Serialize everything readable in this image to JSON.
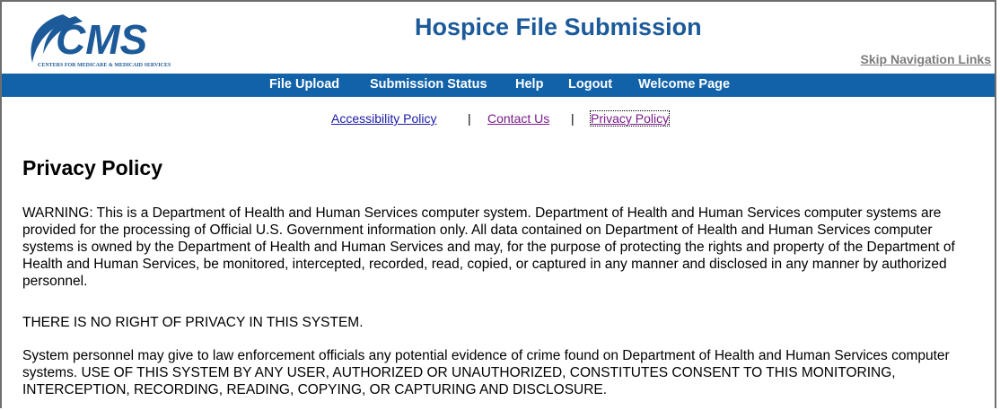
{
  "colors": {
    "brand_blue": "#1c5a9a",
    "nav_bar": "#1162a8",
    "link_visited": "#7b1a8a",
    "link_blue": "#1a1aa6",
    "skip_link_gray": "#7c7c7c"
  },
  "header": {
    "logo_text": "CMS",
    "logo_subtitle": "CENTERS FOR MEDICARE & MEDICAID SERVICES",
    "site_title": "Hospice File Submission",
    "skip_link": "Skip Navigation Links"
  },
  "nav": {
    "items": [
      {
        "label": "File Upload"
      },
      {
        "label": "Submission Status"
      },
      {
        "label": "Help"
      },
      {
        "label": "Logout"
      },
      {
        "label": "Welcome Page"
      }
    ]
  },
  "sublinks": {
    "accessibility": "Accessibility Policy",
    "contact": "Contact Us",
    "privacy": "Privacy Policy",
    "separator": "|"
  },
  "content": {
    "heading": "Privacy Policy",
    "paragraphs": [
      "WARNING: This is a Department of Health and Human Services computer system. Department of Health and Human Services computer systems are provided for the processing of Official U.S. Government information only. All data contained on Department of Health and Human Services computer systems is owned by the Department of Health and Human Services and may, for the purpose of protecting the rights and property of the Department of Health and Human Services, be monitored, intercepted, recorded, read, copied, or captured in any manner and disclosed in any manner by authorized personnel.",
      "THERE IS NO RIGHT OF PRIVACY IN THIS SYSTEM.",
      "System personnel may give to law enforcement officials any potential evidence of crime found on Department of Health and Human Services computer systems. USE OF THIS SYSTEM BY ANY USER, AUTHORIZED OR UNAUTHORIZED, CONSTITUTES CONSENT TO THIS MONITORING, INTERCEPTION, RECORDING, READING, COPYING, OR CAPTURING AND DISCLOSURE."
    ]
  }
}
